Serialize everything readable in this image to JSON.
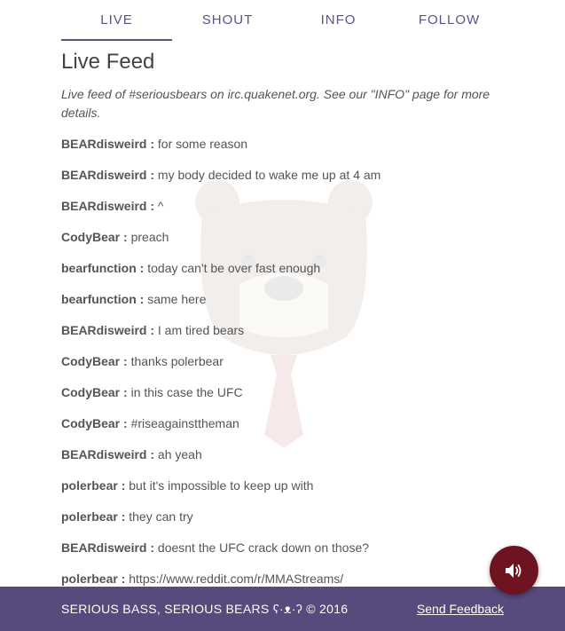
{
  "nav": {
    "tabs": [
      {
        "label": "LIVE",
        "active": true
      },
      {
        "label": "SHOUT",
        "active": false
      },
      {
        "label": "INFO",
        "active": false
      },
      {
        "label": "FOLLOW",
        "active": false
      }
    ]
  },
  "main": {
    "title": "Live Feed",
    "intro": "Live feed of #seriousbears on irc.quakenet.org. See our \"INFO\" page for more details.",
    "messages": [
      {
        "nick": "BEARdisweird :",
        "text": "for some reason"
      },
      {
        "nick": "BEARdisweird :",
        "text": "my body decided to wake me up at 4 am"
      },
      {
        "nick": "BEARdisweird :",
        "text": "^"
      },
      {
        "nick": "CodyBear :",
        "text": "preach"
      },
      {
        "nick": "bearfunction :",
        "text": "today can't be over fast enough"
      },
      {
        "nick": "bearfunction :",
        "text": "same here"
      },
      {
        "nick": "BEARdisweird :",
        "text": "I am tired bears"
      },
      {
        "nick": "CodyBear :",
        "text": "thanks polerbear"
      },
      {
        "nick": "CodyBear :",
        "text": "in this case the UFC"
      },
      {
        "nick": "CodyBear :",
        "text": "#riseagainsttheman"
      },
      {
        "nick": "BEARdisweird :",
        "text": "ah yeah"
      },
      {
        "nick": "polerbear :",
        "text": "but it's impossible to keep up with"
      },
      {
        "nick": "polerbear :",
        "text": "they can try"
      },
      {
        "nick": "BEARdisweird :",
        "text": "doesnt the UFC crack down on those?"
      },
      {
        "nick": "polerbear :",
        "text": "https://www.reddit.com/r/MMAStreams/"
      }
    ]
  },
  "footer": {
    "copyright": "SERIOUS BASS, SERIOUS BEARS ʕ·ᴥ·ʔ © 2016",
    "feedback_label": "Send Feedback"
  },
  "sound_button": {
    "icon": "speaker-volume-icon"
  },
  "watermark": {
    "icon": "bear-with-tie-icon"
  },
  "colors": {
    "accent": "#5e5285",
    "footer_bg": "#574a7c",
    "sound_button_bg": "#6e1420"
  }
}
